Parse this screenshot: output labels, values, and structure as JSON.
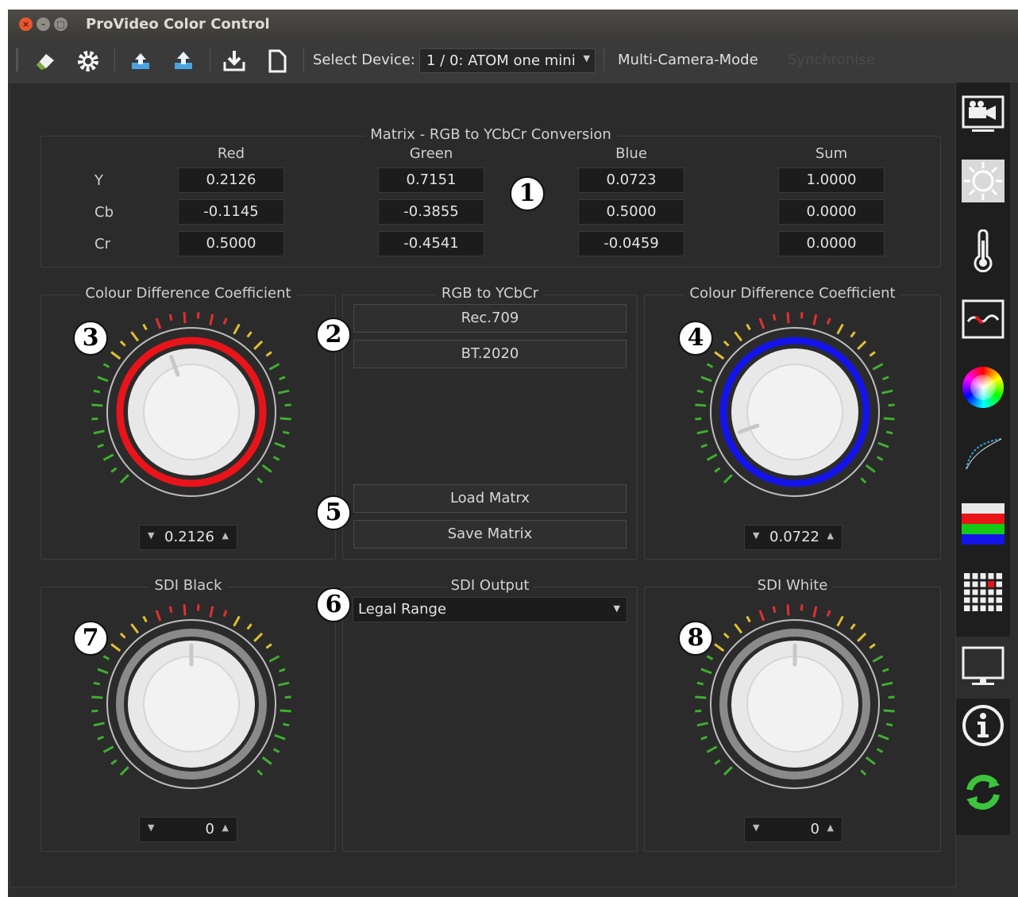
{
  "window": {
    "title": "ProVideo Color Control"
  },
  "toolbar": {
    "icons": [
      "eraser-icon",
      "gear-icon",
      "upload-tray-icon",
      "upload-tray-icon",
      "download-icon",
      "new-document-icon"
    ],
    "select_label": "Select Device:",
    "device_value": "1 / 0: ATOM one mini",
    "multi_camera": "Multi-Camera-Mode",
    "synchronise": "Synchronise"
  },
  "matrix": {
    "title": "Matrix - RGB to YCbCr Conversion",
    "columns": [
      "Red",
      "Green",
      "Blue",
      "Sum"
    ],
    "rows": [
      {
        "label": "Y",
        "values": [
          "0.2126",
          "0.7151",
          "0.0723",
          "1.0000"
        ]
      },
      {
        "label": "Cb",
        "values": [
          "-0.1145",
          "-0.3855",
          "0.5000",
          "0.0000"
        ]
      },
      {
        "label": "Cr",
        "values": [
          "0.5000",
          "-0.4541",
          "-0.0459",
          "0.0000"
        ]
      }
    ]
  },
  "cdc_left": {
    "title": "Colour Difference Coefficient",
    "value": "0.2126",
    "ring_color": "#e8141a"
  },
  "cdc_right": {
    "title": "Colour Difference Coefficient",
    "value": "0.0722",
    "ring_color": "#1414e8"
  },
  "rgb2ycbcr": {
    "title": "RGB to YCbCr",
    "buttons": [
      "Rec.709",
      "BT.2020",
      "Load Matrx",
      "Save Matrix"
    ]
  },
  "sdi_black": {
    "title": "SDI Black",
    "value": "0"
  },
  "sdi_output": {
    "title": "SDI Output",
    "value": "Legal Range"
  },
  "sdi_white": {
    "title": "SDI White",
    "value": "0"
  },
  "badges": [
    "1",
    "2",
    "3",
    "4",
    "5",
    "6",
    "7",
    "8"
  ],
  "sidebar": [
    "camera-icon",
    "brightness-icon",
    "thermometer-icon",
    "waveform-icon",
    "color-wheel-icon",
    "curve-icon",
    "color-bars-icon",
    "grid-icon",
    "monitor-icon",
    "info-icon",
    "refresh-icon"
  ]
}
